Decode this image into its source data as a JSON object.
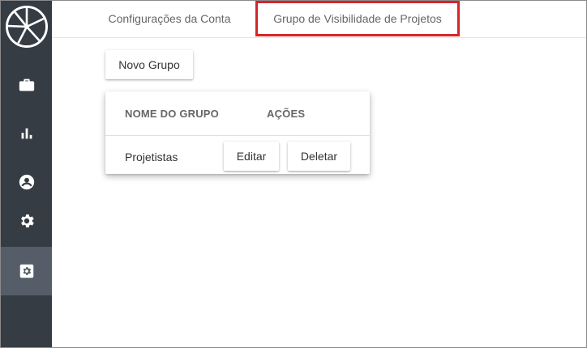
{
  "sidebar": {
    "logo_icon": "aperture-logo-icon",
    "items": [
      {
        "icon": "briefcase-icon"
      },
      {
        "icon": "bar-chart-icon"
      },
      {
        "icon": "account-circle-icon"
      },
      {
        "icon": "gear-icon"
      },
      {
        "icon": "settings-box-icon",
        "active": true
      }
    ],
    "bg_color": "#363c43",
    "active_color": "#545d68"
  },
  "tabs": [
    {
      "label": "Configurações da Conta"
    },
    {
      "label": "Grupo de Visibilidade de Projetos",
      "highlighted": true
    }
  ],
  "highlight_color": "#d2262b",
  "main": {
    "new_group_label": "Novo Grupo",
    "table": {
      "headers": {
        "name": "NOME DO GRUPO",
        "actions": "AÇÕES"
      },
      "rows": [
        {
          "name": "Projetistas",
          "edit_label": "Editar",
          "delete_label": "Deletar"
        }
      ]
    }
  }
}
